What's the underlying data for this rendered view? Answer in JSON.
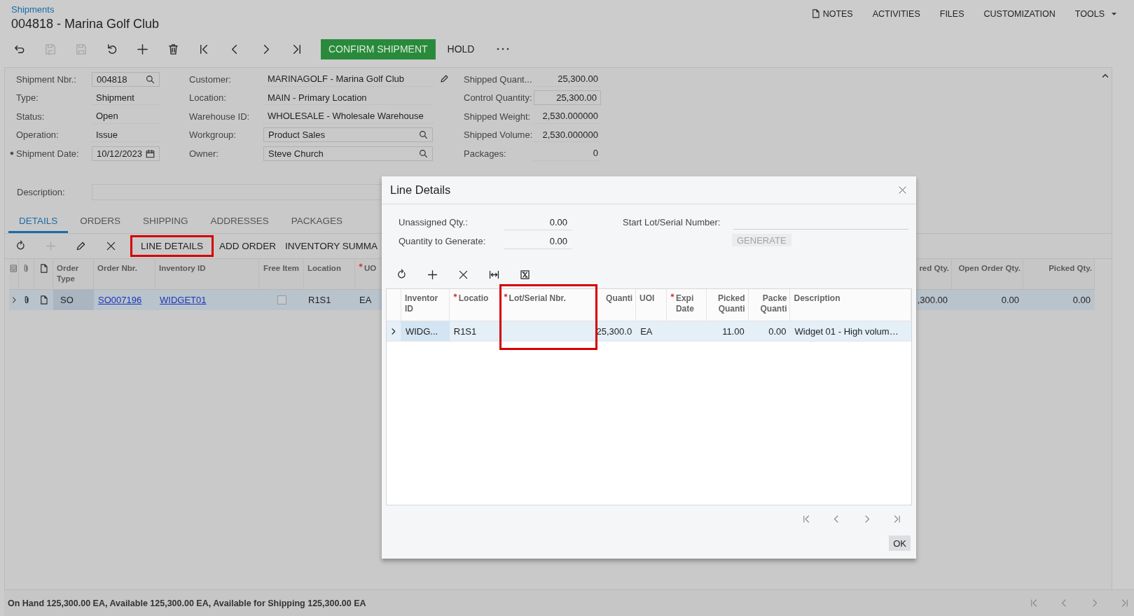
{
  "breadcrumb": "Shipments",
  "title": "004818 - Marina Golf Club",
  "top_menu": [
    {
      "label": "NOTES",
      "kind": "notes"
    },
    {
      "label": "ACTIVITIES",
      "kind": "plain"
    },
    {
      "label": "FILES",
      "kind": "plain"
    },
    {
      "label": "CUSTOMIZATION",
      "kind": "plain"
    },
    {
      "label": "TOOLS",
      "kind": "dropdown"
    }
  ],
  "toolbar": {
    "icons": [
      {
        "kind": "back",
        "disabled": false
      },
      {
        "kind": "save-close",
        "disabled": true
      },
      {
        "kind": "save",
        "disabled": true
      },
      {
        "kind": "undo",
        "disabled": false
      },
      {
        "kind": "add",
        "disabled": false
      },
      {
        "kind": "delete",
        "disabled": false
      },
      {
        "kind": "first",
        "disabled": false
      },
      {
        "kind": "prev",
        "disabled": false
      },
      {
        "kind": "next",
        "disabled": false
      },
      {
        "kind": "last",
        "disabled": false
      }
    ],
    "primary": "CONFIRM SHIPMENT",
    "buttons": [
      "HOLD"
    ]
  },
  "form": {
    "columns": [
      [
        {
          "label": "Shipment Nbr.:",
          "value": "004818",
          "kind": "lookup",
          "required": false
        },
        {
          "label": "Type:",
          "value": "Shipment",
          "kind": "text",
          "required": false
        },
        {
          "label": "Status:",
          "value": "Open",
          "kind": "text",
          "required": false
        },
        {
          "label": "Operation:",
          "value": "Issue",
          "kind": "text",
          "required": false
        },
        {
          "label": "Shipment Date:",
          "value": "10/12/2023",
          "kind": "date",
          "required": true
        }
      ],
      [
        {
          "label": "Customer:",
          "value": "MARINAGOLF - Marina Golf Club",
          "kind": "edit",
          "required": false
        },
        {
          "label": "Location:",
          "value": "MAIN - Primary Location",
          "kind": "text",
          "required": false
        },
        {
          "label": "Warehouse ID:",
          "value": "WHOLESALE - Wholesale Warehouse",
          "kind": "text",
          "required": false
        },
        {
          "label": "Workgroup:",
          "value": "Product Sales",
          "kind": "lookup",
          "required": false
        },
        {
          "label": "Owner:",
          "value": "Steve Church",
          "kind": "lookup",
          "required": false
        }
      ],
      [
        {
          "label": "Shipped Quant...",
          "value": "25,300.00",
          "kind": "number"
        },
        {
          "label": "Control Quantity:",
          "value": "25,300.00",
          "kind": "input"
        },
        {
          "label": "Shipped Weight:",
          "value": "2,530.000000",
          "kind": "number"
        },
        {
          "label": "Shipped Volume:",
          "value": "2,530.000000",
          "kind": "number"
        },
        {
          "label": "Packages:",
          "value": "0",
          "kind": "number"
        }
      ]
    ],
    "description_label": "Description:"
  },
  "tabs": [
    {
      "label": "DETAILS",
      "selected": true
    },
    {
      "label": "ORDERS",
      "selected": false
    },
    {
      "label": "SHIPPING",
      "selected": false
    },
    {
      "label": "ADDRESSES",
      "selected": false
    },
    {
      "label": "PACKAGES",
      "selected": false
    }
  ],
  "grid_toolbar": {
    "icons": [
      {
        "kind": "refresh",
        "disabled": false
      },
      {
        "kind": "add",
        "disabled": true
      },
      {
        "kind": "edit",
        "disabled": false
      },
      {
        "kind": "close",
        "disabled": false
      }
    ],
    "buttons": [
      {
        "label": "LINE DETAILS",
        "highlighted": true
      },
      {
        "label": "ADD ORDER",
        "highlighted": false
      },
      {
        "label": "INVENTORY SUMMA",
        "highlighted": false
      }
    ]
  },
  "grid": {
    "columns": [
      {
        "label": "Order Type",
        "required": false
      },
      {
        "label": "Order Nbr.",
        "required": false
      },
      {
        "label": "Inventory ID",
        "required": false
      },
      {
        "label": "Free Item",
        "required": false
      },
      {
        "label": "Location",
        "required": false
      },
      {
        "label": "UO",
        "required": true
      },
      {
        "label": "red Qty.",
        "required": false
      },
      {
        "label": "Open Order Qty.",
        "required": false
      },
      {
        "label": "Picked Qty.",
        "required": false
      }
    ],
    "rows": [
      {
        "selected": true,
        "cells": [
          {
            "kind": "text",
            "text": "SO"
          },
          {
            "kind": "link",
            "text": "SO007196"
          },
          {
            "kind": "link",
            "text": "WIDGET01"
          },
          {
            "kind": "checkbox",
            "checked": false
          },
          {
            "kind": "text",
            "text": "R1S1"
          },
          {
            "kind": "text",
            "text": "EA"
          },
          {
            "kind": "number",
            "text": ",300.00"
          },
          {
            "kind": "number",
            "text": "0.00"
          },
          {
            "kind": "number",
            "text": "0.00"
          }
        ]
      }
    ]
  },
  "status_bar": "On Hand 125,300.00 EA, Available 125,300.00 EA, Available for Shipping 125,300.00 EA",
  "dialog": {
    "title": "Line Details",
    "fields": [
      {
        "label": "Unassigned Qty.:",
        "value": "0.00"
      },
      {
        "label": "Quantity to Generate:",
        "value": "0.00"
      }
    ],
    "start_label": "Start Lot/Serial Number:",
    "generate": {
      "label": "GENERATE",
      "disabled": true
    },
    "toolbar": [
      {
        "kind": "refresh"
      },
      {
        "kind": "add"
      },
      {
        "kind": "close"
      },
      {
        "kind": "fit"
      },
      {
        "kind": "excel"
      }
    ],
    "columns": [
      {
        "label": "Inventor ID",
        "required": false,
        "highlighted": false
      },
      {
        "label": "Locatio",
        "required": true,
        "highlighted": false
      },
      {
        "label": "Lot/Serial Nbr.",
        "required": true,
        "highlighted": true
      },
      {
        "label": "Quanti",
        "required": false,
        "highlighted": false
      },
      {
        "label": "UOI",
        "required": false,
        "highlighted": false
      },
      {
        "label": "Expi Date",
        "required": true,
        "highlighted": false
      },
      {
        "label": "Picked Quanti",
        "required": false,
        "highlighted": false
      },
      {
        "label": "Packe Quanti",
        "required": false,
        "highlighted": false
      },
      {
        "label": "Description",
        "required": false,
        "highlighted": false
      }
    ],
    "rows": [
      {
        "selected": true,
        "cells": [
          {
            "kind": "text",
            "text": "WIDG..."
          },
          {
            "kind": "text",
            "text": "R1S1"
          },
          {
            "kind": "empty"
          },
          {
            "kind": "number",
            "text": "25,300.0"
          },
          {
            "kind": "text",
            "text": "EA"
          },
          {
            "kind": "empty"
          },
          {
            "kind": "number",
            "text": "11.00"
          },
          {
            "kind": "number",
            "text": "0.00"
          },
          {
            "kind": "text",
            "text": "Widget 01 - High volum…"
          }
        ]
      }
    ],
    "ok": "OK"
  }
}
